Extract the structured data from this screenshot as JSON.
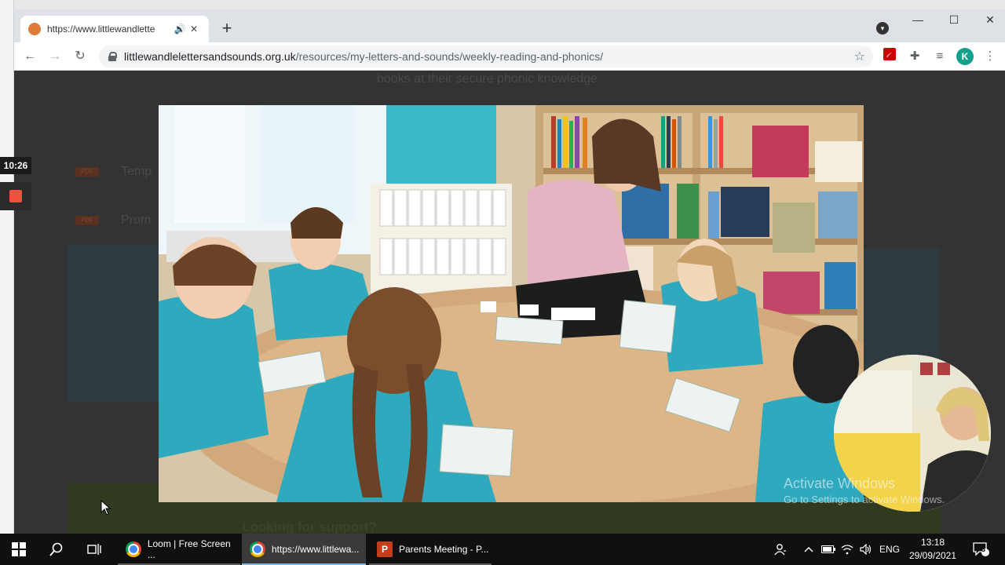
{
  "timer": {
    "text": "10:26"
  },
  "browser": {
    "tab": {
      "title": "https://www.littlewandlette"
    },
    "new_tab": "+",
    "url": {
      "host": "littlewandlelettersandsounds.org.uk",
      "path": "/resources/my-letters-and-sounds/weekly-reading-and-phonics/"
    },
    "avatar_letter": "K"
  },
  "page": {
    "top_text": "books at their secure phonic knowledge.",
    "rows": [
      {
        "badge": "PDF",
        "label": "Temp"
      },
      {
        "badge": "PDF",
        "label": "Prom"
      }
    ],
    "support_text": "Looking for support?"
  },
  "watermark": {
    "title": "Activate Windows",
    "subtitle": "Go to Settings to activate Windows."
  },
  "taskbar": {
    "apps": [
      {
        "label": "Loom | Free Screen ...",
        "icon": "chrome-icon"
      },
      {
        "label": "https://www.littlewa...",
        "icon": "chrome-icon",
        "active": true
      },
      {
        "label": "Parents Meeting - P...",
        "icon": "powerpoint-icon"
      }
    ],
    "language": "ENG",
    "time": "13:18",
    "date": "29/09/2021",
    "notification_count": "3"
  },
  "colors": {
    "accent": "#76b9ed",
    "record": "#f05040",
    "avatar": "#14a08a",
    "pdf_icon": "#cc0000"
  }
}
